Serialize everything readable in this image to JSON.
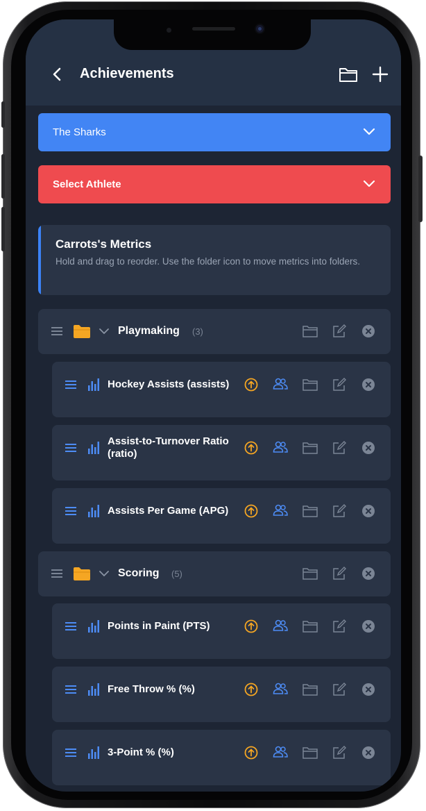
{
  "header": {
    "title": "Achievements"
  },
  "team_select": {
    "value": "The Sharks"
  },
  "athlete_select": {
    "value": "Select Athlete"
  },
  "info": {
    "title": "Carrots's Metrics",
    "description": "Hold and drag to reorder. Use the folder icon to move metrics into folders."
  },
  "folders": [
    {
      "name": "Playmaking",
      "count": "(3)",
      "metrics": [
        "Hockey Assists (assists)",
        "Assist-to-Turnover Ratio (ratio)",
        "Assists Per Game (APG)"
      ]
    },
    {
      "name": "Scoring",
      "count": "(5)",
      "metrics": [
        "Points in Paint (PTS)",
        "Free Throw % (%)",
        "3-Point % (%)"
      ]
    }
  ],
  "icons": [
    "back-chevron-icon",
    "folder-icon",
    "plus-icon",
    "chevron-down-icon",
    "drag-handle-icon",
    "bar-chart-icon",
    "arrow-up-circle-icon",
    "users-icon",
    "edit-icon",
    "close-circle-icon"
  ],
  "colors": {
    "background": "#1d2534",
    "card": "#2a3446",
    "accent_blue": "#4285f4",
    "accent_red": "#ef4b4f",
    "folder": "#f5a623",
    "arrow_orange": "#f5a623",
    "icon_blue": "#4d8cf5",
    "muted": "#7b8595"
  }
}
